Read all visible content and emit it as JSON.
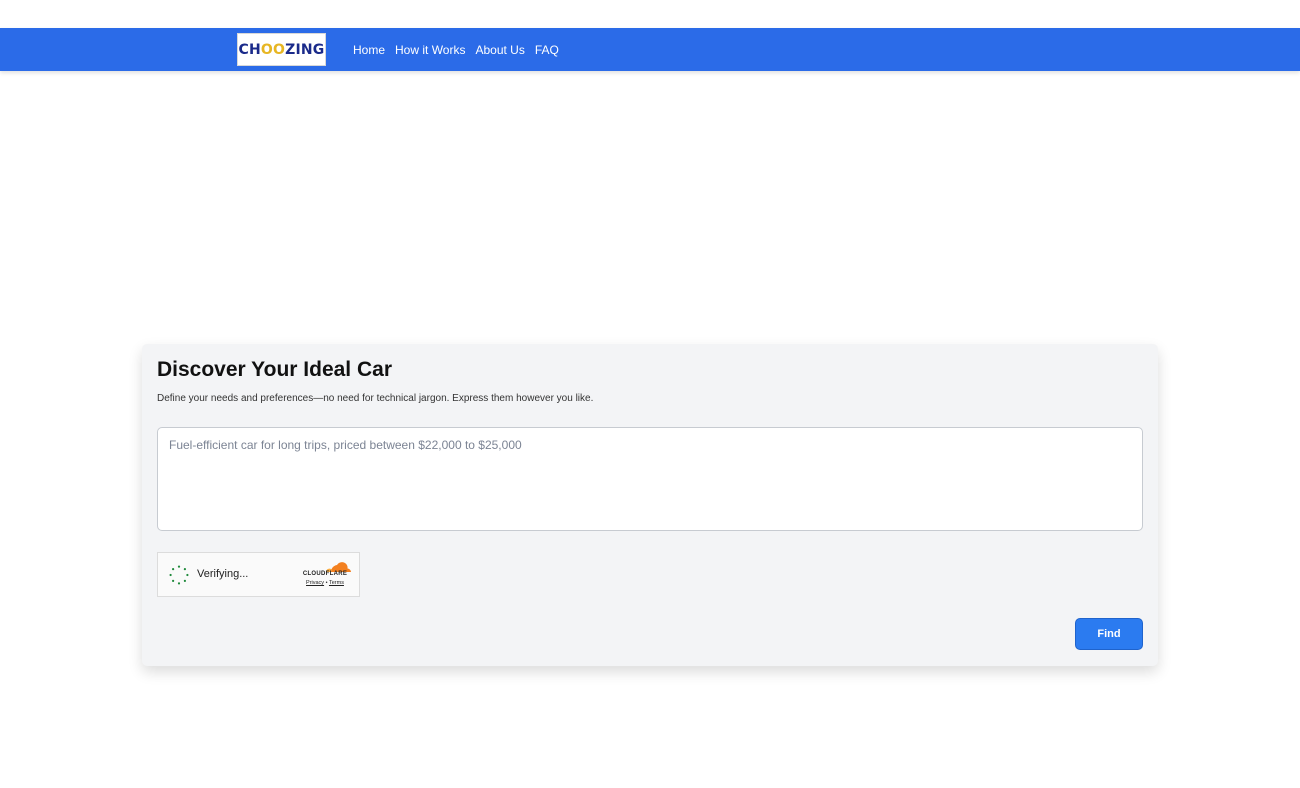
{
  "header": {
    "logo": {
      "part1": "CH",
      "part2": "OO",
      "part3": "ZING"
    },
    "nav": [
      {
        "label": "Home"
      },
      {
        "label": "How it Works"
      },
      {
        "label": "About Us"
      },
      {
        "label": "FAQ"
      }
    ]
  },
  "main": {
    "title": "Discover Your Ideal Car",
    "subtitle": "Define your needs and preferences—no need for technical jargon. Express them however you like.",
    "query": {
      "value": "",
      "placeholder": "Fuel-efficient car for long trips, priced between $22,000 to $25,000"
    },
    "captcha": {
      "status": "Verifying...",
      "brand": "CLOUDFLARE",
      "privacy_label": "Privacy",
      "separator": "•",
      "terms_label": "Terms"
    },
    "find_label": "Find"
  },
  "colors": {
    "navbar": "#2b6be8",
    "button": "#2b7bf0",
    "logo_primary": "#1a2a8a",
    "logo_accent": "#e7b623",
    "cloudflare_orange": "#f38020"
  },
  "icons": {
    "spinner": "loading-spinner-icon",
    "cloudflare": "cloudflare-cloud-icon"
  }
}
